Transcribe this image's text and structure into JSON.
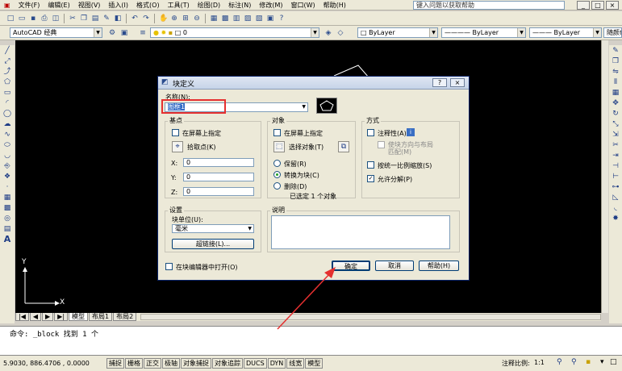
{
  "menubar": {
    "items": [
      "文件(F)",
      "编辑(E)",
      "视图(V)",
      "插入(I)",
      "格式(O)",
      "工具(T)",
      "绘图(D)",
      "标注(N)",
      "修改(M)",
      "窗口(W)",
      "帮助(H)"
    ],
    "help_search_placeholder": "键入问题以获取帮助"
  },
  "window_buttons": [
    "_",
    "□",
    "×"
  ],
  "toolbar2": {
    "workspace": "AutoCAD 经典",
    "layer": "0",
    "color": "ByLayer",
    "linetype": "ByLayer",
    "lineweight": "ByLayer",
    "plotstyle": "随颜色"
  },
  "tabs": {
    "nav_arrows": [
      "|◀",
      "◀",
      "▶",
      "▶|"
    ],
    "items": [
      "模型",
      "布局1",
      "布局2"
    ]
  },
  "canvas": {
    "ucs_y": "Y",
    "ucs_x": "X"
  },
  "cmdline": {
    "text": "命令: _block 找到 1 个"
  },
  "statusbar": {
    "coords": "5.9030,  886.4706 , 0.0000",
    "buttons": [
      "捕捉",
      "栅格",
      "正交",
      "极轴",
      "对象捕捉",
      "对象追踪",
      "DUCS",
      "DYN",
      "线宽",
      "模型"
    ],
    "scale_label": "注释比例:",
    "scale_value": "1:1"
  },
  "dialog": {
    "title": "块定义",
    "help_btn": "?",
    "close_btn": "×",
    "name_label": "名称(N):",
    "name_value": "图框1",
    "basepoint": {
      "title": "基点",
      "on_screen": "在屏幕上指定",
      "pick_point": "拾取点(K)",
      "x_label": "X:",
      "y_label": "Y:",
      "z_label": "Z:",
      "x_value": "0",
      "y_value": "0",
      "z_value": "0"
    },
    "objects": {
      "title": "对象",
      "on_screen": "在屏幕上指定",
      "select_objects": "选择对象(T)",
      "retain": "保留(R)",
      "convert": "转换为块(C)",
      "delete": "删除(D)",
      "selected_count": "已选定 1 个对象"
    },
    "behavior": {
      "title": "方式",
      "annotative": "注释性(A)",
      "match_orient": "使块方向与布局",
      "match_orient2": "匹配(M)",
      "scale_uniform": "按统一比例缩放(S)",
      "allow_explode": "允许分解(P)"
    },
    "settings": {
      "title": "设置",
      "unit_label": "块单位(U):",
      "unit_value": "毫米",
      "hyperlink": "超链接(L)..."
    },
    "description": {
      "title": "说明"
    },
    "open_in_editor": "在块编辑器中打开(O)",
    "ok": "确定",
    "cancel": "取消",
    "help": "帮助(H)"
  },
  "colors": {
    "highlight_box": "#e53030",
    "arrow": "#e53030",
    "canvas_bg": "#000000"
  }
}
